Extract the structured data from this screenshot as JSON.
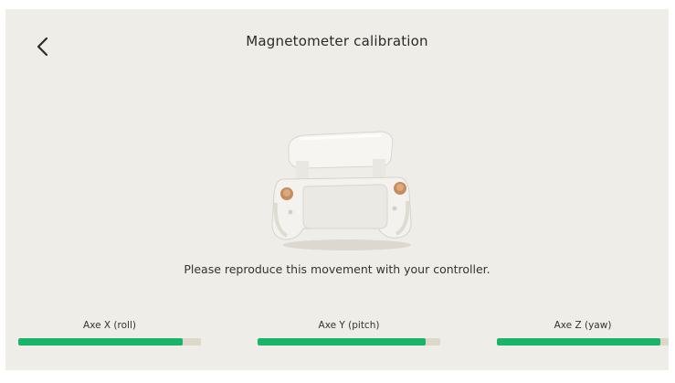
{
  "header": {
    "title": "Magnetometer calibration",
    "back_icon": "chevron-left-icon"
  },
  "illustration": {
    "subject": "controller-illustration"
  },
  "instruction": "Please reproduce this movement with your controller.",
  "axes": [
    {
      "label": "Axe X (roll)",
      "progress": 0.9
    },
    {
      "label": "Axe Y (pitch)",
      "progress": 0.92
    },
    {
      "label": "Axe Z (yaw)",
      "progress": 0.95
    }
  ],
  "colors": {
    "background": "#efede7",
    "progress_fill": "#19b46a",
    "progress_track": "#ddd7c9"
  }
}
